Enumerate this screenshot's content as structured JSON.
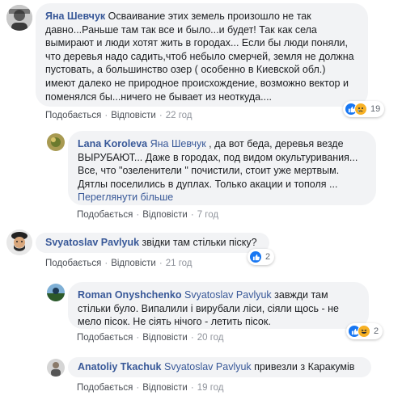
{
  "comments": [
    {
      "author": "Яна Шевчук",
      "mention": "",
      "text": " Осваивание этих земель произошло не так давно...Раньше там так все и было...и будет! Так как села вымирают и люди хотят жить в городах... Если бы люди поняли, что деревья надо садить,чтоб небыло смерчей, земля не должна пустовать, а большинство озер ( особенно в Киевской обл.) имеют далеко не природное происхождение, возможно вектор и поменялся бы...ничего не бывает из неоткуда....",
      "see_more": "",
      "like": "Подобається",
      "reply": "Відповісти",
      "time": "22 год",
      "reactions": {
        "count": "19",
        "types": [
          "like-icon",
          "sad-icon"
        ]
      },
      "avatar_color": "#6b6b6b"
    },
    {
      "author": "Lana Koroleva",
      "mention": "Яна Шевчук",
      "text": " , да вот беда, деревья везде ВЫРУБАЮТ... Даже в городах, под видом окультуривания... Все, что \"озеленители \" почистили, стоит уже мертвым. Дятлы поселились в дуплах. Только акации и тополя ... ",
      "see_more": "Переглянути більше",
      "like": "Подобається",
      "reply": "Відповісти",
      "time": "7 год",
      "reactions": null,
      "avatar_color": "#9a8b4a"
    },
    {
      "author": "Svyatoslav Pavlyuk",
      "mention": "",
      "text": " звідки там стільки піску?",
      "see_more": "",
      "like": "Подобається",
      "reply": "Відповісти",
      "time": "21 год",
      "reactions": {
        "count": "2",
        "types": [
          "like-icon"
        ]
      },
      "avatar_color": "#3b3b3b"
    },
    {
      "author": "Roman Onyshchenko",
      "mention": "Svyatoslav Pavlyuk",
      "text": " завжди там стільки було. Випалили і вирубали ліси, сіяли щось - не мело пісок. Не сіять нічого - летить пісок.",
      "see_more": "",
      "like": "Подобається",
      "reply": "Відповісти",
      "time": "20 год",
      "reactions": {
        "count": "2",
        "types": [
          "like-icon",
          "haha-icon"
        ]
      },
      "avatar_color": "#2d5a7a"
    },
    {
      "author": "Anatoliy Tkachuk",
      "mention": "Svyatoslav Pavlyuk",
      "text": " привезли з Каракумів",
      "see_more": "",
      "like": "Подобається",
      "reply": "Відповісти",
      "time": "19 год",
      "reactions": null,
      "avatar_color": "#888888"
    }
  ],
  "separator": "·"
}
